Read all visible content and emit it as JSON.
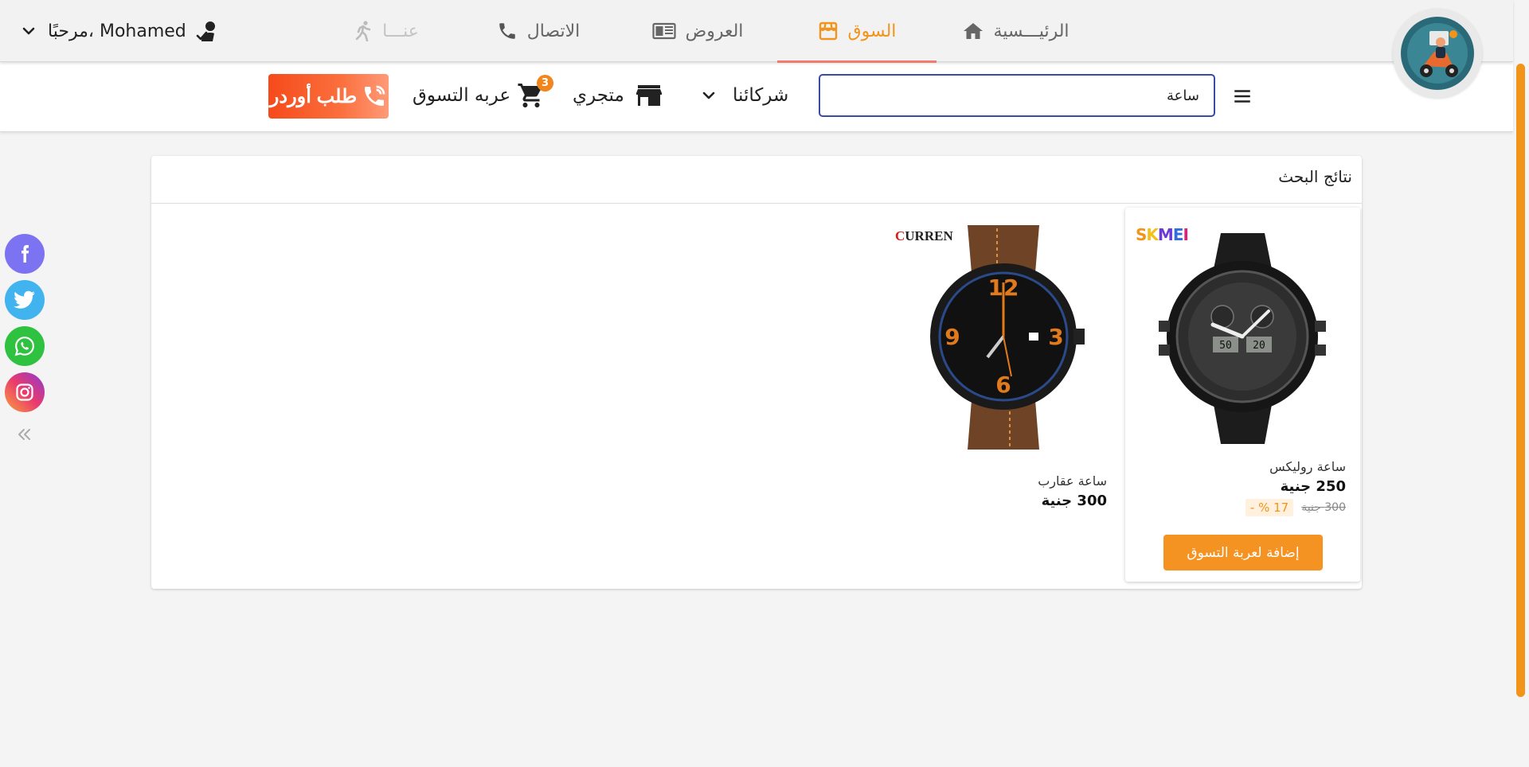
{
  "topnav": {
    "user_greeting": "مرحبًا، Mohamed",
    "tabs": [
      {
        "id": "home",
        "label": "الرئيـــسية",
        "icon": "home-icon"
      },
      {
        "id": "market",
        "label": "السوق",
        "icon": "store-icon",
        "active": true
      },
      {
        "id": "offers",
        "label": "العروض",
        "icon": "newspaper-icon"
      },
      {
        "id": "contact",
        "label": "الاتصال",
        "icon": "phone-icon"
      },
      {
        "id": "about",
        "label": "عنـــا",
        "icon": "walking-icon"
      }
    ]
  },
  "subbar": {
    "search_value": "ساعة",
    "companies_label": "شركائنا",
    "mystore_label": "متجري",
    "cart_label": "عربه التسوق",
    "cart_count": "3",
    "order_button": "طلب أوردر"
  },
  "results": {
    "title": "نتائج البحث",
    "products": [
      {
        "name": "ساعة روليكس",
        "price": "250 جنية",
        "old_price": "300 جنية",
        "discount": "17 % -",
        "brand": "SKMEI",
        "add_to_cart": "إضافة لعربة التسوق"
      },
      {
        "name": "ساعة عقارب",
        "price": "300 جنية",
        "brand": "CURREN"
      }
    ]
  },
  "social": [
    "facebook",
    "twitter",
    "whatsapp",
    "instagram"
  ],
  "colors": {
    "accent": "#f2941a",
    "active_underline": "#ef7c6c",
    "search_border": "#3b4aa6",
    "order_button": "#f64a1b",
    "facebook": "#7b73f2",
    "twitter": "#41b3ee",
    "whatsapp": "#2fc140"
  }
}
